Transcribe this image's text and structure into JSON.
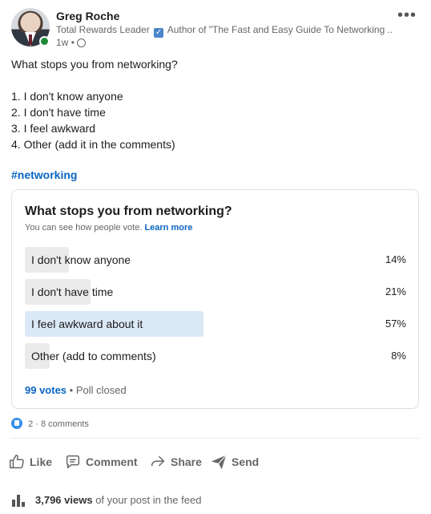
{
  "author": {
    "name": "Greg Roche",
    "headline_before": "Total Rewards Leader",
    "headline_after": "Author of \"The Fast and Easy Guide To Networking ...",
    "time": "1w",
    "meta_separator": "•"
  },
  "menu": {
    "more_label": "•••"
  },
  "post": {
    "lines": [
      "What stops you from networking?",
      "",
      "1. I don't know anyone",
      "2. I don't have time",
      "3. I feel awkward",
      "4. Other (add it in the comments)"
    ],
    "hashtag": "#networking"
  },
  "poll": {
    "question": "What stops you from networking?",
    "note": "You can see how people vote.",
    "learn_more": "Learn more",
    "options": [
      {
        "label": "I don't know anyone",
        "percent_text": "14%",
        "percent": 14,
        "selected": false
      },
      {
        "label": "I don't have time",
        "percent_text": "21%",
        "percent": 21,
        "selected": false
      },
      {
        "label": "I feel awkward about it",
        "percent_text": "57%",
        "percent": 57,
        "selected": true
      },
      {
        "label": "Other (add to comments)",
        "percent_text": "8%",
        "percent": 8,
        "selected": false
      }
    ],
    "votes": "99 votes",
    "status": "• Poll closed"
  },
  "social": {
    "reactions": "2",
    "separator": "·",
    "comments": "8 comments"
  },
  "actions": {
    "like": "Like",
    "comment": "Comment",
    "share": "Share",
    "send": "Send"
  },
  "views": {
    "count": "3,796 views",
    "suffix": "of your post in the feed"
  },
  "colors": {
    "accent": "#0a66c2",
    "selected_bar": "#dbe9f7",
    "bar": "#ebebeb",
    "online": "#1f8a3a"
  }
}
